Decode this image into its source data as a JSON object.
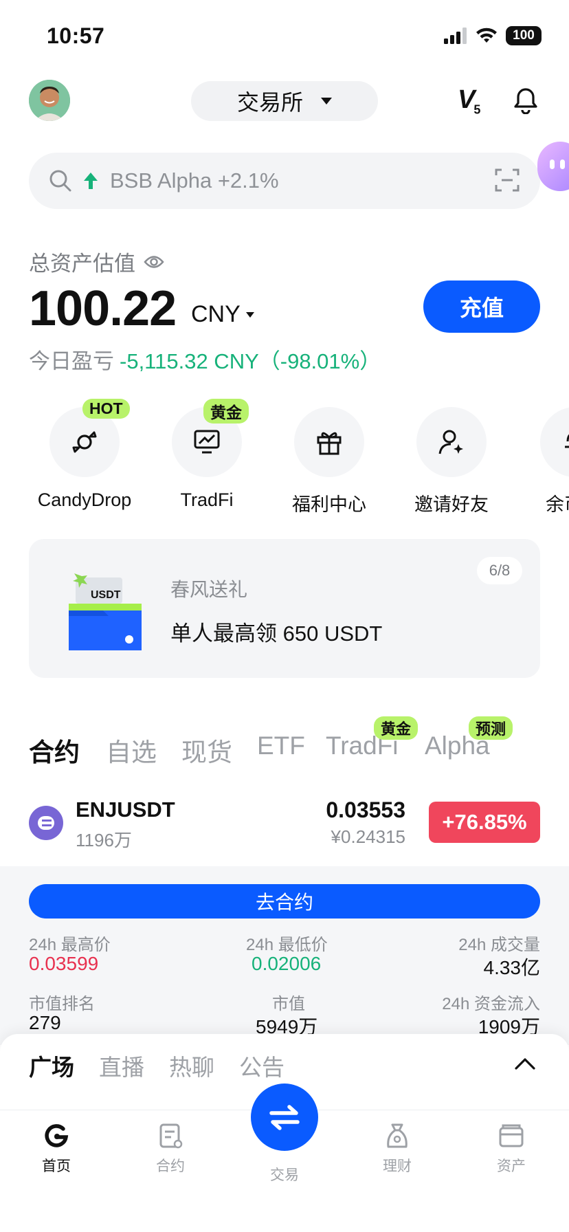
{
  "status_bar": {
    "time": "10:57",
    "battery": "100"
  },
  "header": {
    "exchange_label": "交易所",
    "vip_level": "V",
    "vip_sub": "5"
  },
  "search": {
    "trend_text": "BSB Alpha +2.1%"
  },
  "assets": {
    "label": "总资产估值",
    "value": "100.22",
    "unit": "CNY",
    "pnl_label": "今日盈亏",
    "pnl_value": "-5,115.32 CNY（-98.01%）",
    "deposit_label": "充值"
  },
  "quick_entries": [
    {
      "label": "CandyDrop",
      "badge": "HOT",
      "icon": "candy-icon"
    },
    {
      "label": "TradFi",
      "badge": "黄金",
      "icon": "chart-monitor-icon"
    },
    {
      "label": "福利中心",
      "badge": "",
      "icon": "gift-icon"
    },
    {
      "label": "邀请好友",
      "badge": "",
      "icon": "invite-user-icon"
    },
    {
      "label": "余币宝",
      "badge": "",
      "icon": "piggy-icon"
    }
  ],
  "promo": {
    "subtitle": "春风送礼",
    "title": "单人最高领 650 USDT",
    "page": "6/8",
    "ticket_text": "USDT"
  },
  "market_tabs": [
    {
      "label": "合约",
      "active": true,
      "badge": ""
    },
    {
      "label": "自选",
      "active": false,
      "badge": ""
    },
    {
      "label": "现货",
      "active": false,
      "badge": ""
    },
    {
      "label": "ETF",
      "active": false,
      "badge": ""
    },
    {
      "label": "TradFi",
      "active": false,
      "badge": "黄金"
    },
    {
      "label": "Alpha",
      "active": false,
      "badge": "预测"
    }
  ],
  "ticker": {
    "symbol": "ENJUSDT",
    "volume": "1196万",
    "price": "0.03553",
    "price_cny": "¥0.24315",
    "change": "+76.85%",
    "go_button": "去合约",
    "stats": [
      {
        "label": "24h 最高价",
        "value": "0.03599"
      },
      {
        "label": "24h 最低价",
        "value": "0.02006"
      },
      {
        "label": "24h 成交量",
        "value": "4.33亿"
      },
      {
        "label": "市值排名",
        "value": "279"
      },
      {
        "label": "市值",
        "value": "5949万"
      },
      {
        "label": "24h 资金流入",
        "value": "1909万"
      }
    ]
  },
  "feed_tabs": [
    "广场",
    "直播",
    "热聊",
    "公告"
  ],
  "bottom_nav": [
    {
      "label": "首页",
      "icon": "home-icon",
      "active": true
    },
    {
      "label": "合约",
      "icon": "contract-icon",
      "active": false
    },
    {
      "label": "交易",
      "icon": "swap-icon",
      "active": false
    },
    {
      "label": "理财",
      "icon": "finance-icon",
      "active": false
    },
    {
      "label": "资产",
      "icon": "wallet-icon",
      "active": false
    }
  ],
  "colors": {
    "brand_blue": "#0a5bff",
    "up_green": "#17b27a",
    "down_red": "#f0465c",
    "badge_lime": "#b8f26a"
  }
}
